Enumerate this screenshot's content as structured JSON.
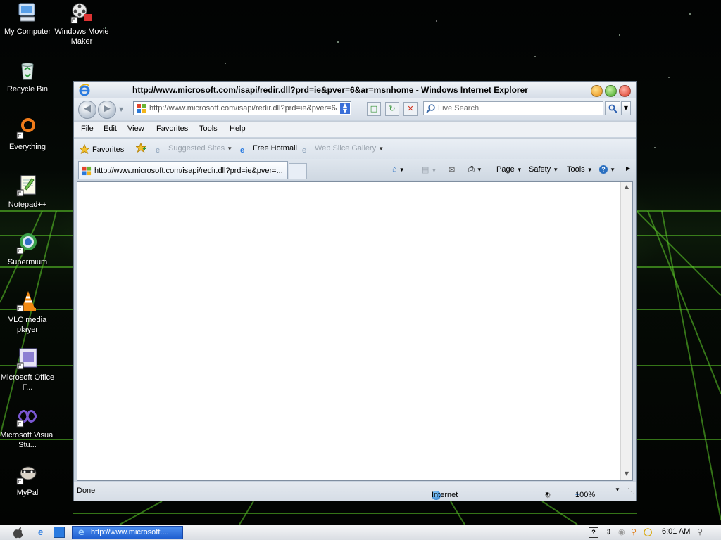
{
  "desktop": {
    "icons": [
      {
        "label": "My Computer"
      },
      {
        "label": "Windows Movie Maker"
      },
      {
        "label": "Recycle Bin"
      },
      {
        "label": "Everything"
      },
      {
        "label": "Notepad++"
      },
      {
        "label": "Supermium"
      },
      {
        "label": "VLC media player"
      },
      {
        "label": "Microsoft Office F..."
      },
      {
        "label": "Microsoft Visual Stu..."
      },
      {
        "label": "MyPal"
      }
    ]
  },
  "window": {
    "title": "http://www.microsoft.com/isapi/redir.dll?prd=ie&pver=6&ar=msnhome - Windows Internet Explorer",
    "address": "http://www.microsoft.com/isapi/redir.dll?prd=ie&pver=6&ar",
    "search_placeholder": "Live Search",
    "menu": [
      "File",
      "Edit",
      "View",
      "Favorites",
      "Tools",
      "Help"
    ],
    "favorites_bar": {
      "favorites": "Favorites",
      "suggested_sites": "Suggested Sites",
      "free_hotmail": "Free Hotmail",
      "web_slice_gallery": "Web Slice Gallery"
    },
    "tab_title": "http://www.microsoft.com/isapi/redir.dll?prd=ie&pver=...",
    "command_bar": {
      "page": "Page",
      "safety": "Safety",
      "tools": "Tools"
    },
    "status": {
      "text": "Done",
      "zone": "Internet",
      "zoom": "100%"
    }
  },
  "taskbar": {
    "task_title": "http://www.microsoft....",
    "clock": "6:01 AM"
  },
  "colors": {
    "accent": "#1f5fd0",
    "title_text": "#000000"
  }
}
